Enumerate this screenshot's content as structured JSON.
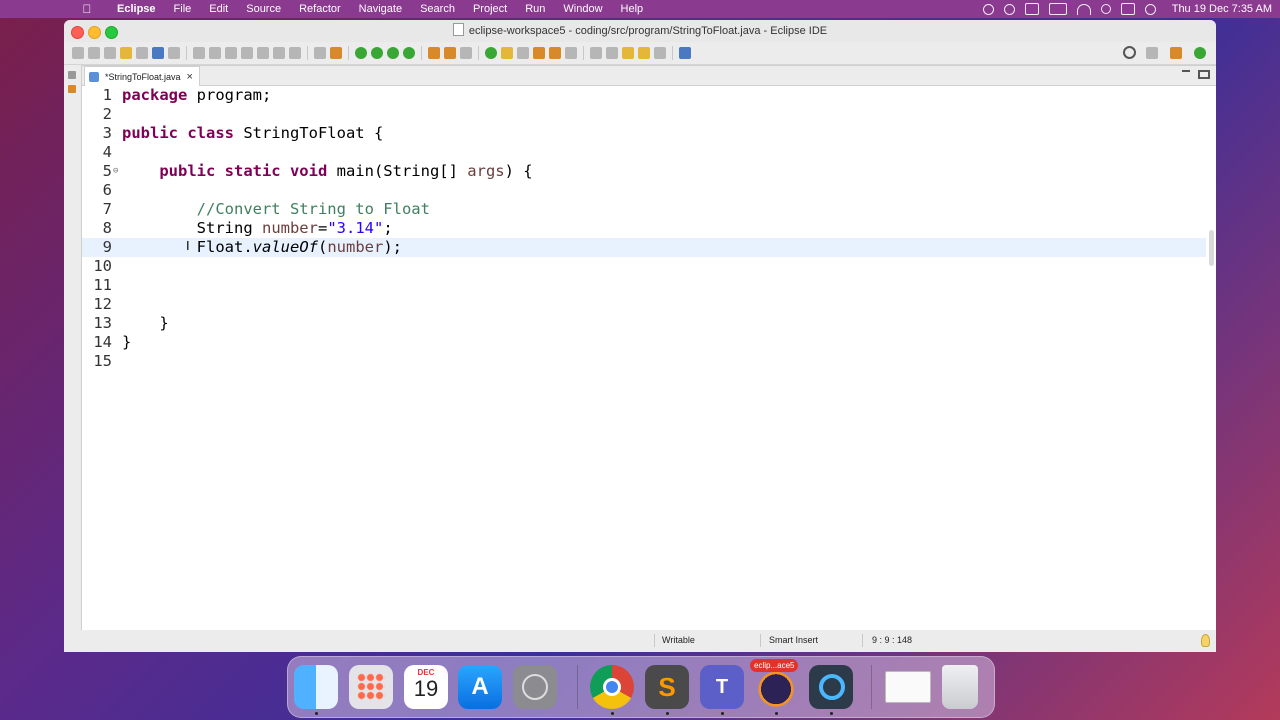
{
  "menubar": {
    "app_name": "Eclipse",
    "items": [
      "File",
      "Edit",
      "Source",
      "Refactor",
      "Navigate",
      "Search",
      "Project",
      "Run",
      "Window",
      "Help"
    ],
    "clock": "Thu 19 Dec  7:35 AM"
  },
  "window": {
    "title": "eclipse-workspace5 - coding/src/program/StringToFloat.java - Eclipse IDE"
  },
  "editor": {
    "tab_label": "*StringToFloat.java",
    "active_line": 9,
    "lines": [
      {
        "n": "1",
        "text": "package program;"
      },
      {
        "n": "2",
        "text": ""
      },
      {
        "n": "3",
        "text": "public class StringToFloat {"
      },
      {
        "n": "4",
        "text": ""
      },
      {
        "n": "5",
        "text": "    public static void main(String[] args) {"
      },
      {
        "n": "6",
        "text": ""
      },
      {
        "n": "7",
        "text": "        //Convert String to Float"
      },
      {
        "n": "8",
        "text": "        String number=\"3.14\";"
      },
      {
        "n": "9",
        "text": "        Float.valueOf(number);"
      },
      {
        "n": "10",
        "text": ""
      },
      {
        "n": "11",
        "text": ""
      },
      {
        "n": "12",
        "text": ""
      },
      {
        "n": "13",
        "text": "    }"
      },
      {
        "n": "14",
        "text": "}"
      },
      {
        "n": "15",
        "text": ""
      }
    ]
  },
  "status": {
    "writable": "Writable",
    "insert_mode": "Smart Insert",
    "position": "9 : 9 : 148"
  },
  "dock": {
    "calendar_month": "DEC",
    "calendar_day": "19",
    "eclipse_badge": "eclip...ace5",
    "items": [
      "finder",
      "launchpad",
      "calendar",
      "app-store",
      "system-preferences",
      "chrome",
      "sublime-text",
      "teams",
      "eclipse",
      "quicktime",
      "screenshot",
      "trash"
    ]
  },
  "colors": {
    "keyword": "#7f0055",
    "comment": "#3f7f5f",
    "string": "#2a00ff",
    "variable": "#6a3e3e",
    "active_line": "#e8f2fe"
  }
}
